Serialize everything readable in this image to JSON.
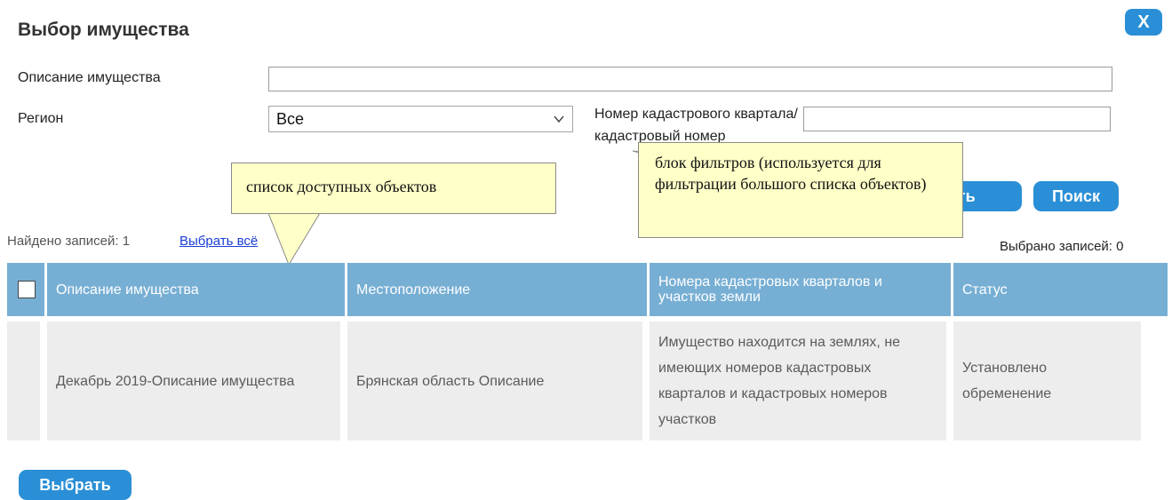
{
  "dialog": {
    "title": "Выбор имущества",
    "close_label": "X"
  },
  "filters": {
    "description_label": "Описание имущества",
    "description_value": "",
    "region_label": "Регион",
    "region_value": "Все",
    "cadastral_label": "Номер кадастрового квартала/кадастровый номер",
    "cadastral_value": "",
    "clear_label": "Очистить",
    "search_label": "Поиск"
  },
  "callouts": {
    "list": "список доступных объектов",
    "filters": "блок фильтров (используется для фильтрации большого списка объектов)"
  },
  "results": {
    "found_text": "Найдено записей: 1",
    "select_all_label": "Выбрать всё",
    "selected_text": "Выбрано записей: 0"
  },
  "table": {
    "headers": [
      "Описание имущества",
      "Местоположение",
      "Номера кадастровых кварталов и участков земли",
      "Статус"
    ],
    "rows": [
      {
        "description": "Декабрь 2019-Описание имущества",
        "location": "Брянская область Описание",
        "cadastral": "Имущество находится на землях, не имеющих номеров кадастровых кварталов и кадастровых номеров участков",
        "status": "Установлено обременение"
      }
    ]
  },
  "footer": {
    "select_label": "Выбрать"
  },
  "colors": {
    "accent": "#2a8fd6",
    "header_bg": "#77afd4",
    "row_bg": "#ededed",
    "callout_bg": "#ffffc8",
    "link": "#1a3fd6"
  },
  "icons": [
    "chevron-down-icon",
    "close-icon",
    "checkbox-icon"
  ]
}
